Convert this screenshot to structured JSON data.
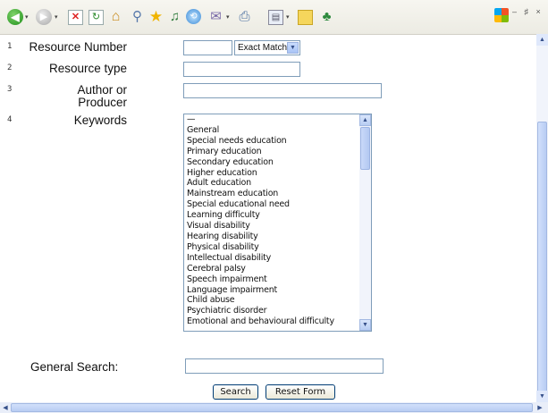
{
  "toolbar": {
    "icons": [
      "back-icon",
      "forward-icon",
      "stop-icon",
      "refresh-icon",
      "home-icon",
      "search-icon",
      "favorites-icon",
      "media-icon",
      "history-icon",
      "mail-icon",
      "print-icon",
      "edit-icon",
      "discuss-icon",
      "messenger-icon"
    ],
    "window_controls": "– ♯ ×"
  },
  "rows": [
    {
      "num": "1",
      "label": "Resource Number"
    },
    {
      "num": "2",
      "label": "Resource type"
    },
    {
      "num": "3",
      "label_line1": "Author or",
      "label_line2": "Producer"
    },
    {
      "num": "4",
      "label": "Keywords"
    }
  ],
  "resource_number": {
    "value": "",
    "match_option": "Exact Match"
  },
  "resource_type": {
    "value": ""
  },
  "author": {
    "value": ""
  },
  "keywords": {
    "options": [
      "—",
      "General",
      "Special needs education",
      "Primary education",
      "Secondary education",
      "Higher education",
      "Adult education",
      "Mainstream education",
      "Special educational need",
      "Learning difficulty",
      "Visual disability",
      "Hearing disability",
      "Physical disability",
      "Intellectual disability",
      "Cerebral palsy",
      "Speech impairment",
      "Language impairment",
      "Child abuse",
      "Psychiatric disorder",
      "Emotional and behavioural difficulty"
    ]
  },
  "general_search": {
    "label": "General Search:",
    "value": ""
  },
  "buttons": {
    "search": "Search",
    "reset": "Reset Form"
  }
}
